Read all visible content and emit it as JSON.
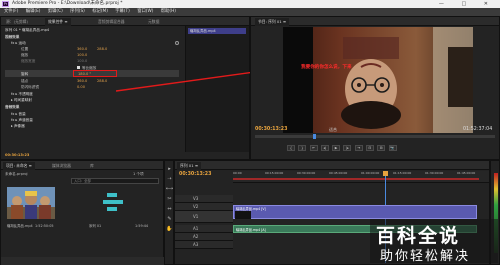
{
  "window": {
    "title": "Adobe Premiere Pro - E:\\Download\\未命名.prproj *",
    "logo": "Pr",
    "controls": "— □ ✕"
  },
  "menu": [
    "文件(F)",
    "编辑(E)",
    "剪辑(C)",
    "序列(S)",
    "标记(M)",
    "字幕(T)",
    "窗口(W)",
    "帮助(H)"
  ],
  "effect_panel": {
    "tabs": [
      "源：(无剪辑)",
      "效果控件 ≡",
      "音频剪辑混合器",
      "元数据"
    ],
    "clip_path": "序列 01 * 瞎胡乱弄品.mp4",
    "section_video": "视频效果",
    "motion": "fx ▸ 运动",
    "position_label": "位置",
    "position_x": "360.0",
    "position_y": "288.0",
    "scale_label": "缩放",
    "scale_value": "100.0",
    "scale_w_label": "缩放宽度",
    "scale_w_value": "100.0",
    "uniform_scale": "等比缩放",
    "rotation_label": "旋转",
    "rotation_value": "180.0 °",
    "anchor_label": "锚点",
    "anchor_x": "360.0",
    "anchor_y": "288.0",
    "antiflicker_label": "防闪烁滤镜",
    "antiflicker_value": "0.00",
    "opacity": "fx ▸ 不透明度",
    "timeremap": "▸ 时间重映射",
    "section_audio": "音频效果",
    "volume": "fx ▸ 音量",
    "channel_volume": "fx ▸ 声道音量",
    "panner": "▸ 声像器",
    "footer_tc": "00:30:13:23",
    "mini_clip": "瞎胡乱弄品.mp4"
  },
  "program": {
    "tab": "节目: 序列 01 ≡",
    "overlay_text": "我要你的你怎么说，下来",
    "tc_left": "00:30:13:23",
    "fit": "适合",
    "tc_right": "01:52:37:04",
    "controls": [
      "{",
      "}",
      "⇤",
      "◂|",
      "▶",
      "|▸",
      "⇥",
      "⊟",
      "⊞",
      "📷"
    ]
  },
  "project": {
    "tabs": [
      "项目: 未命名 ≡",
      "媒体浏览器",
      "库"
    ],
    "file": "未命名.prproj",
    "items_count": "1 个项",
    "search_placeholder": "入口：全部",
    "clip1_name": "瞎胡乱弄品.mp4",
    "clip1_dur": "1:52:50:05",
    "clip2_name": "序列 01",
    "clip2_dur": "1:59:44"
  },
  "timeline": {
    "tab": "序列 01 ≡",
    "tc": "00:30:13:23",
    "ruler": [
      "00:00",
      "00:15:00:00",
      "00:30:00:00",
      "00:45:00:00",
      "01:00:00:00",
      "01:15:00:00",
      "01:30:00:00",
      "01:45:00:00"
    ],
    "tracks": [
      "V3",
      "V2",
      "V1",
      "A1",
      "A2",
      "A3"
    ],
    "video_clip": "瞎胡乱弄品.mp4 [V]",
    "audio_clip": "瞎胡乱弄品.mp4 [A]"
  },
  "watermark": {
    "title": "百科全说",
    "subtitle": "助你轻松解决"
  }
}
